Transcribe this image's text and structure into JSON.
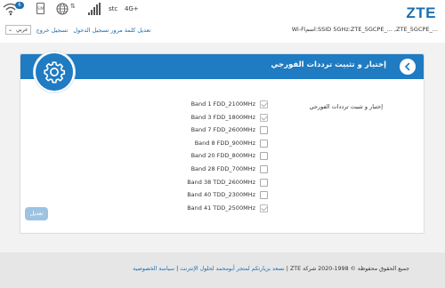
{
  "header": {
    "logo": "ZTE",
    "ssid_line": "Wi-Fiاسم:SSID 5GHz:ZTE_5GCPE_... ,ZTE_5GCPE_...",
    "carrier": "stc",
    "network_type": "4G+",
    "wifi_clients": "6",
    "sim_label": "SIM",
    "language_select": "عربي",
    "logout_link": "تسجيل خروج",
    "change_password_link": "تعديل كلمة مرور تسجيل الدخول"
  },
  "card": {
    "title": "إختيار و تثبيت ترددات الفورجي",
    "field_label": "إختيار و تثبيت ترددات الفورجي",
    "bands": [
      {
        "label": "Band 1 FDD_2100MHz",
        "checked": true
      },
      {
        "label": "Band 3 FDD_1800MHz",
        "checked": true
      },
      {
        "label": "Band 7 FDD_2600MHz",
        "checked": false
      },
      {
        "label": "Band 8 FDD_900MHz",
        "checked": false
      },
      {
        "label": "Band 20 FDD_800MHz",
        "checked": false
      },
      {
        "label": "Band 28 FDD_700MHz",
        "checked": false
      },
      {
        "label": "Band 38 TDD_2600MHz",
        "checked": false
      },
      {
        "label": "Band 40 TDD_2300MHz",
        "checked": false
      },
      {
        "label": "Band 41 TDD_2500MHz",
        "checked": true
      }
    ],
    "apply_label": "تعديل"
  },
  "footer": {
    "copyright": "جميع الحقوق محفوظة © 1998-2020 شركة",
    "brand": "ZTE",
    "privacy_link": "سياسة الخصوصية",
    "thanks_link": "نسعد بزيارتكم لمتجر أبومحمد لحلول الإنترنت",
    "separator": "|"
  },
  "colors": {
    "accent": "#1f7bc2",
    "logo": "#1a6fb3",
    "apply_button": "#9dc3e3"
  }
}
